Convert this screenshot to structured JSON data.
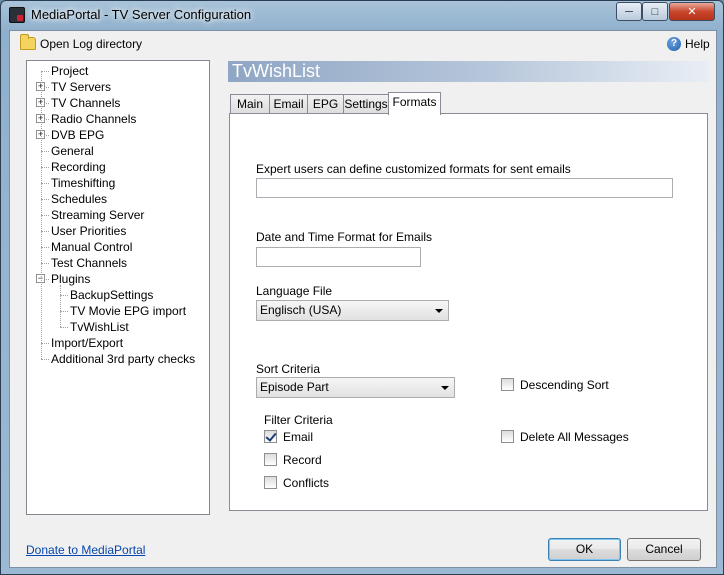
{
  "window": {
    "title": "MediaPortal - TV Server Configuration"
  },
  "toolbar": {
    "open_log": "Open Log directory",
    "help": "Help"
  },
  "tree": [
    {
      "label": "Project",
      "expandable": false,
      "level": 0
    },
    {
      "label": "TV Servers",
      "expandable": true,
      "level": 0
    },
    {
      "label": "TV Channels",
      "expandable": true,
      "level": 0
    },
    {
      "label": "Radio Channels",
      "expandable": true,
      "level": 0
    },
    {
      "label": "DVB EPG",
      "expandable": true,
      "level": 0
    },
    {
      "label": "General",
      "expandable": false,
      "level": 0
    },
    {
      "label": "Recording",
      "expandable": false,
      "level": 0
    },
    {
      "label": "Timeshifting",
      "expandable": false,
      "level": 0
    },
    {
      "label": "Schedules",
      "expandable": false,
      "level": 0
    },
    {
      "label": "Streaming Server",
      "expandable": false,
      "level": 0
    },
    {
      "label": "User Priorities",
      "expandable": false,
      "level": 0
    },
    {
      "label": "Manual Control",
      "expandable": false,
      "level": 0
    },
    {
      "label": "Test Channels",
      "expandable": false,
      "level": 0
    },
    {
      "label": "Plugins",
      "expandable": true,
      "expanded": true,
      "level": 0
    },
    {
      "label": "BackupSettings",
      "expandable": false,
      "level": 1
    },
    {
      "label": "TV Movie EPG import",
      "expandable": false,
      "level": 1
    },
    {
      "label": "TvWishList",
      "expandable": false,
      "level": 1,
      "selected": true
    },
    {
      "label": "Import/Export",
      "expandable": false,
      "level": 0
    },
    {
      "label": "Additional 3rd party checks",
      "expandable": false,
      "level": 0
    }
  ],
  "banner": {
    "title": "TvWishList"
  },
  "tabs": [
    {
      "label": "Main"
    },
    {
      "label": "Email"
    },
    {
      "label": "EPG"
    },
    {
      "label": "Settings"
    },
    {
      "label": "Formats",
      "active": true
    }
  ],
  "formats": {
    "custom_formats_label": "Expert users can define customized formats for sent emails",
    "custom_formats_value": "",
    "datetime_label": "Date and Time Format for Emails",
    "datetime_value": "",
    "language_label": "Language File",
    "language_value": "Englisch (USA)",
    "sort_label": "Sort Criteria",
    "sort_value": "Episode Part",
    "descending_label": "Descending Sort",
    "descending_checked": false,
    "filter_label": "Filter Criteria",
    "filter_email_label": "Email",
    "filter_email_checked": true,
    "filter_record_label": "Record",
    "filter_record_checked": false,
    "filter_conflicts_label": "Conflicts",
    "filter_conflicts_checked": false,
    "delete_all_label": "Delete All Messages",
    "delete_all_checked": false
  },
  "footer": {
    "donate_link": "Donate to MediaPortal",
    "ok": "OK",
    "cancel": "Cancel"
  },
  "colors": {
    "banner_start": "#8fa6c4",
    "link": "#0645ad",
    "titlebar": "#a9c3d9"
  }
}
